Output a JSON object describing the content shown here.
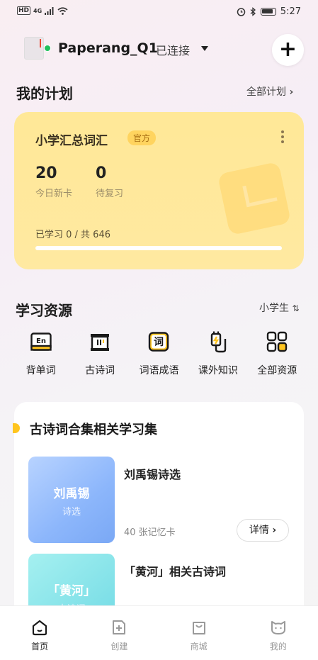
{
  "status_bar": {
    "left_badges": [
      "HD",
      "4G"
    ],
    "time": "5:27"
  },
  "device": {
    "name": "Paperang_Q1",
    "status": "已连接"
  },
  "plan_section": {
    "title": "我的计划",
    "link": "全部计划"
  },
  "plan_card": {
    "title": "小学汇总词汇",
    "tag": "官方",
    "new_count": "20",
    "new_label": "今日新卡",
    "review_count": "0",
    "review_label": "待复习",
    "progress_text": "已学习 0 / 共 646",
    "progress_fraction": 0
  },
  "resources_section": {
    "title": "学习资源",
    "filter": "小学生",
    "items": [
      {
        "label": "背单词",
        "icon": "En-icon",
        "icon_text": "En"
      },
      {
        "label": "古诗词",
        "icon": "poem-scroll-icon"
      },
      {
        "label": "词语成语",
        "icon": "word-icon",
        "icon_text": "词"
      },
      {
        "label": "课外知识",
        "icon": "knowledge-plug-icon"
      },
      {
        "label": "全部资源",
        "icon": "grid-icon"
      }
    ]
  },
  "collection": {
    "title": "古诗词合集相关学习集",
    "decks": [
      {
        "cover_main": "刘禹锡",
        "cover_sub": "诗选",
        "title": "刘禹锡诗选",
        "count": "40 张记忆卡",
        "button": "详情"
      },
      {
        "cover_main": "「黄河」",
        "cover_sub": "古诗词",
        "title": "「黄河」相关古诗词"
      }
    ]
  },
  "tabbar": {
    "items": [
      {
        "label": "首页",
        "icon": "home-icon",
        "active": true
      },
      {
        "label": "创建",
        "icon": "create-icon",
        "active": false
      },
      {
        "label": "商城",
        "icon": "shop-bag-icon",
        "active": false
      },
      {
        "label": "我的",
        "icon": "cat-profile-icon",
        "active": false
      }
    ]
  },
  "colors": {
    "accent_yellow": "#ffc51f",
    "plan_card_bg": "#ffe897",
    "online_green": "#20c05c"
  }
}
